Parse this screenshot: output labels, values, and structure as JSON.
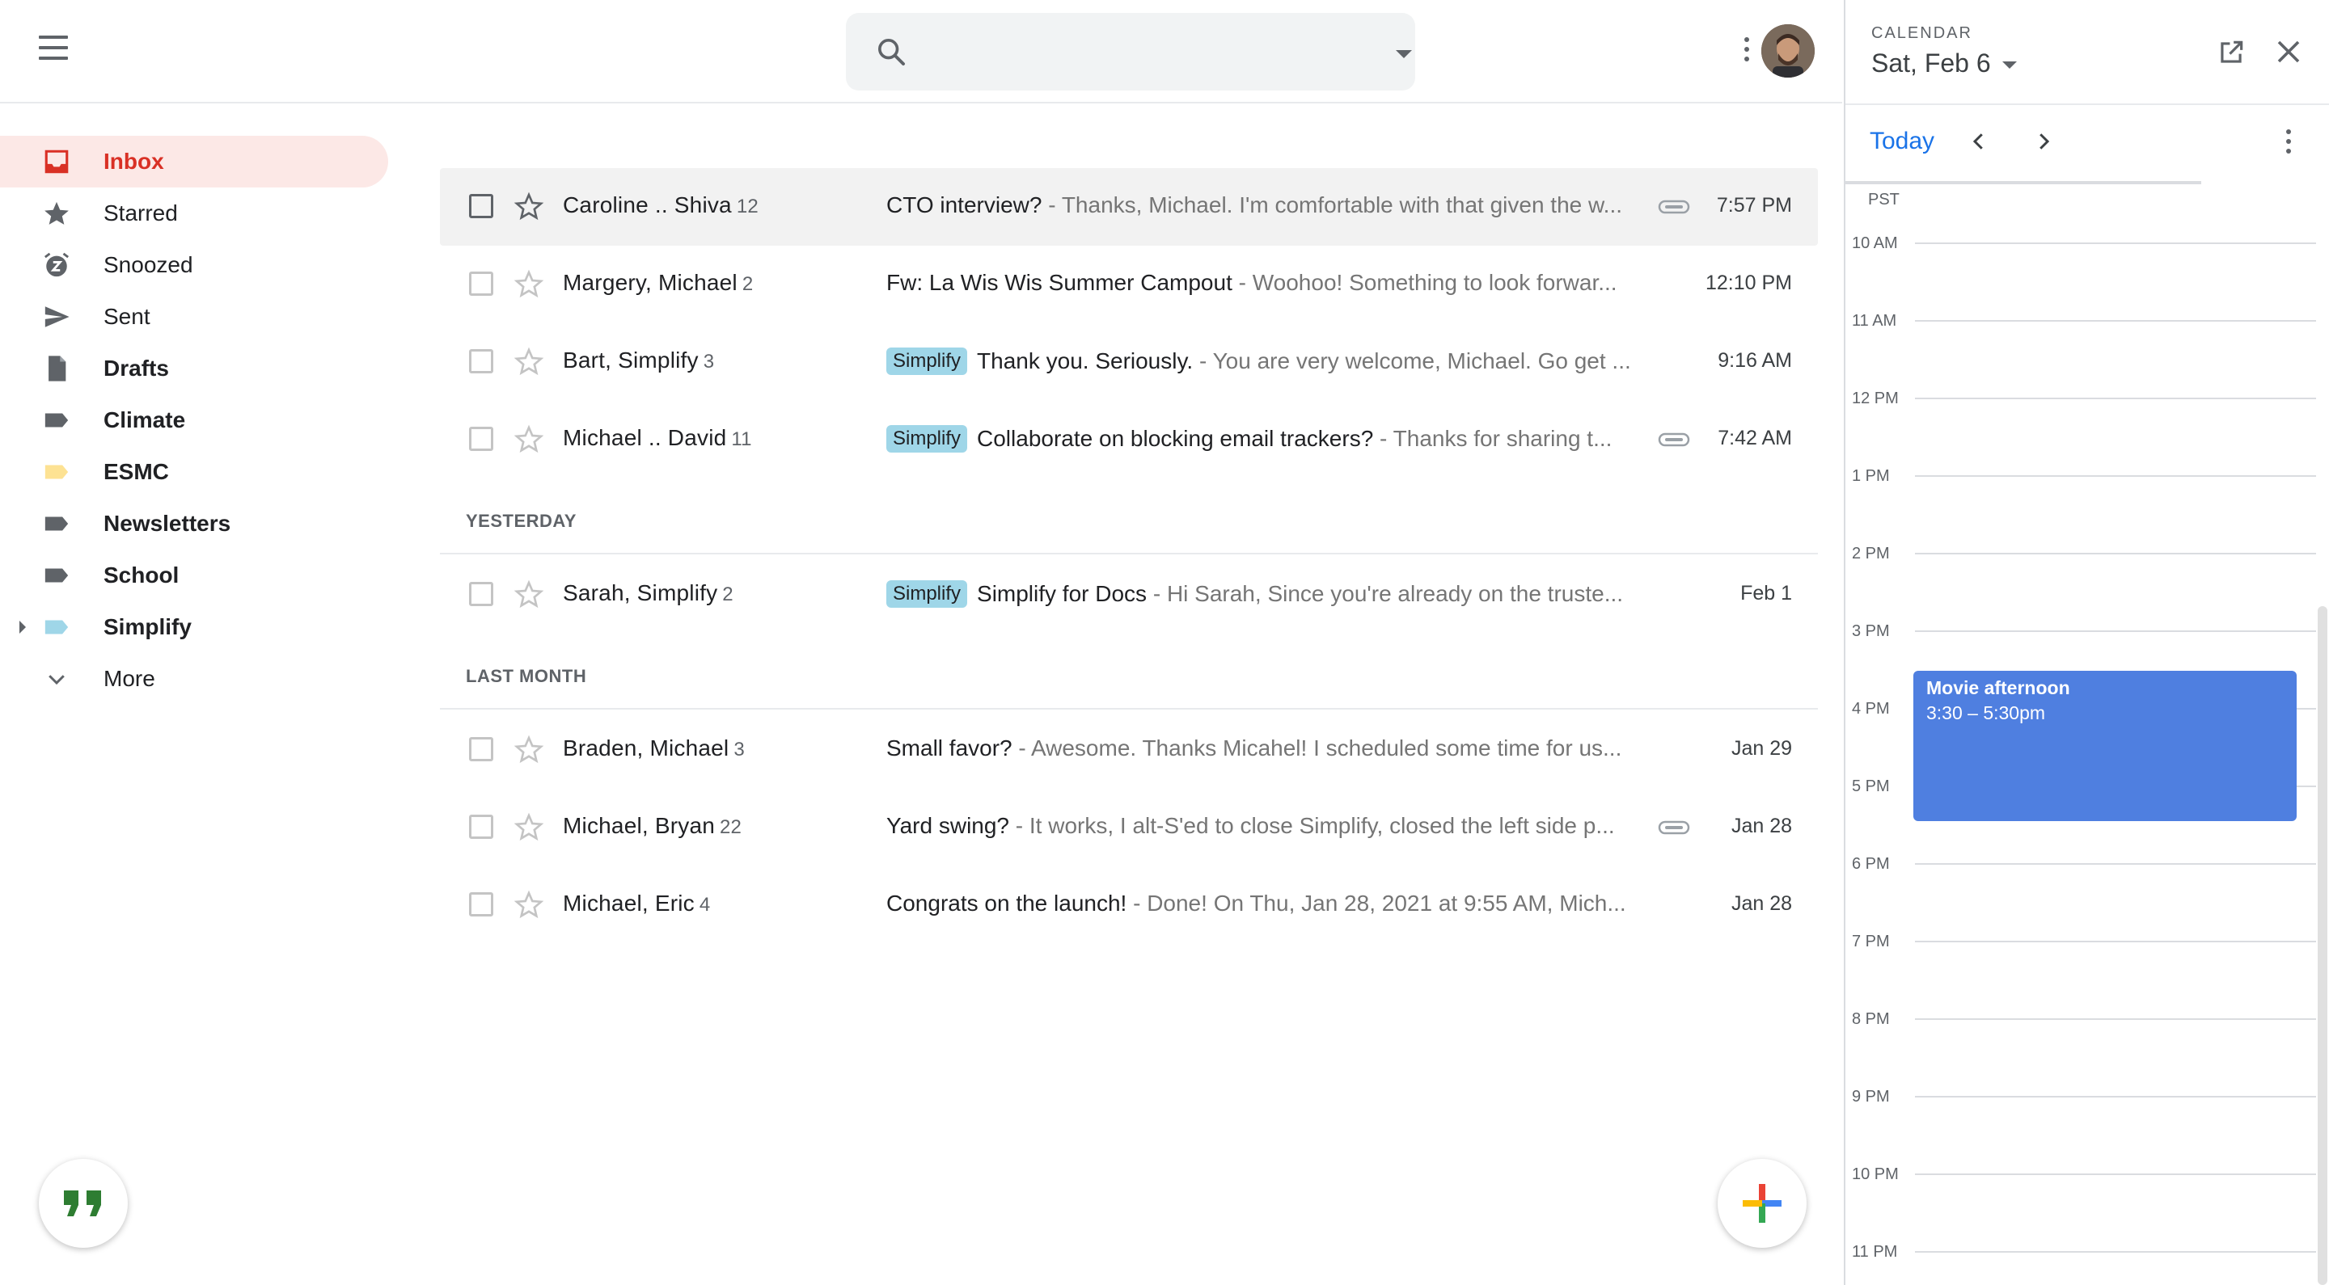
{
  "search": {
    "placeholder": ""
  },
  "sidebar": {
    "items": [
      {
        "label": "Inbox"
      },
      {
        "label": "Starred"
      },
      {
        "label": "Snoozed"
      },
      {
        "label": "Sent"
      },
      {
        "label": "Drafts"
      },
      {
        "label": "Climate",
        "color": "#5f6368"
      },
      {
        "label": "ESMC",
        "color": "#fde293"
      },
      {
        "label": "Newsletters",
        "color": "#5f6368"
      },
      {
        "label": "School",
        "color": "#5f6368"
      },
      {
        "label": "Simplify",
        "color": "#9fd6e8"
      },
      {
        "label": "More"
      }
    ]
  },
  "colors": {
    "accent_red": "#d93025",
    "active_bg": "#fce8e6",
    "simplify_tag": "#9fd6e8",
    "event_blue": "#4f7fe0",
    "link_blue": "#1a73e8"
  },
  "mail": {
    "today": [
      {
        "sender": "Caroline .. Shiva",
        "count": "12",
        "tag": "",
        "subject": "CTO interview?",
        "snippet": " - Thanks, Michael. I'm comfortable with that given the w...",
        "attachment": true,
        "date": "7:57 PM"
      },
      {
        "sender": "Margery, Michael",
        "count": "2",
        "tag": "",
        "subject": "Fw: La Wis Wis Summer Campout",
        "snippet": " - Woohoo! Something to look forwar...",
        "attachment": false,
        "date": "12:10 PM"
      },
      {
        "sender": "Bart, Simplify",
        "count": "3",
        "tag": "Simplify",
        "subject": "Thank you. Seriously.",
        "snippet": " - You are very welcome, Michael. Go get ...",
        "attachment": false,
        "date": "9:16 AM"
      },
      {
        "sender": "Michael .. David",
        "count": "11",
        "tag": "Simplify",
        "subject": "Collaborate on blocking email trackers?",
        "snippet": " - Thanks for sharing t...",
        "attachment": true,
        "date": "7:42 AM"
      }
    ],
    "yesterday_label": "YESTERDAY",
    "yesterday": [
      {
        "sender": "Sarah, Simplify",
        "count": "2",
        "tag": "Simplify",
        "subject": "Simplify for Docs",
        "snippet": " - Hi Sarah, Since you're already on the truste...",
        "attachment": false,
        "date": "Feb 1"
      }
    ],
    "last_month_label": "LAST MONTH",
    "last_month": [
      {
        "sender": "Braden, Michael",
        "count": "3",
        "tag": "",
        "subject": "Small favor?",
        "snippet": " - Awesome. Thanks Micahel! I scheduled some time for us...",
        "attachment": false,
        "date": "Jan 29"
      },
      {
        "sender": "Michael, Bryan",
        "count": "22",
        "tag": "",
        "subject": "Yard swing?",
        "snippet": " - It works, I alt-S'ed to close Simplify, closed the left side p...",
        "attachment": true,
        "date": "Jan 28"
      },
      {
        "sender": "Michael, Eric",
        "count": "4",
        "tag": "",
        "subject": "Congrats on the launch!",
        "snippet": " - Done! On Thu, Jan 28, 2021 at 9:55 AM, Mich...",
        "attachment": false,
        "date": "Jan 28"
      }
    ]
  },
  "calendar": {
    "kicker": "CALENDAR",
    "date": "Sat, Feb 6",
    "today_label": "Today",
    "timezone": "PST",
    "hours": [
      "10 AM",
      "11 AM",
      "12 PM",
      "1 PM",
      "2 PM",
      "3 PM",
      "4 PM",
      "5 PM",
      "6 PM",
      "7 PM",
      "8 PM",
      "9 PM",
      "10 PM",
      "11 PM"
    ],
    "event": {
      "title": "Movie afternoon",
      "time": "3:30 – 5:30pm"
    }
  }
}
